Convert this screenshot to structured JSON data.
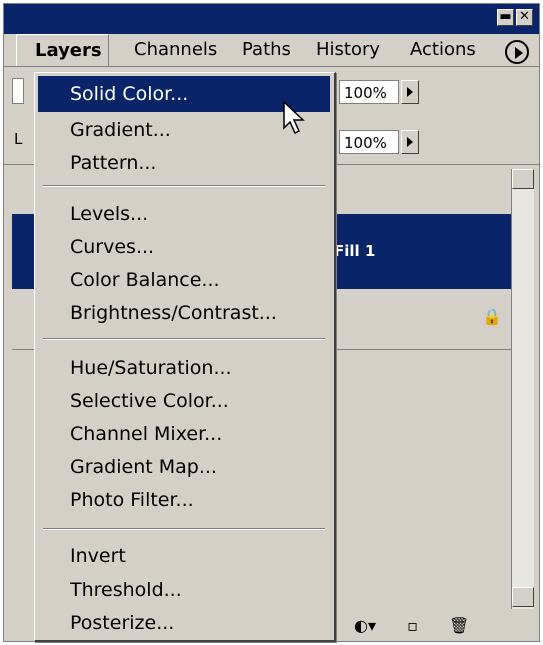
{
  "tabs": [
    {
      "label": "Layers",
      "active": true
    },
    {
      "label": "Channels",
      "active": false
    },
    {
      "label": "Paths",
      "active": false
    },
    {
      "label": "History",
      "active": false
    },
    {
      "label": "Actions",
      "active": false
    }
  ],
  "panel": {
    "opacity_value": "100%",
    "fill_value": "100%",
    "lock_label": "L",
    "selected_layer_name": "Fill 1"
  },
  "menu": {
    "items": [
      {
        "label": "Solid Color...",
        "highlighted": true
      },
      {
        "label": "Gradient..."
      },
      {
        "label": "Pattern..."
      },
      {
        "label": "Levels..."
      },
      {
        "label": "Curves..."
      },
      {
        "label": "Color Balance..."
      },
      {
        "label": "Brightness/Contrast..."
      },
      {
        "label": "Hue/Saturation..."
      },
      {
        "label": "Selective Color..."
      },
      {
        "label": "Channel Mixer..."
      },
      {
        "label": "Gradient Map..."
      },
      {
        "label": "Photo Filter..."
      },
      {
        "label": "Invert"
      },
      {
        "label": "Threshold..."
      },
      {
        "label": "Posterize..."
      }
    ]
  },
  "icons": [
    "minimize-icon",
    "close-icon",
    "palette-menu-icon",
    "lock-icon",
    "adjustment-layer-icon",
    "new-layer-icon",
    "trash-icon",
    "cursor-icon"
  ],
  "colors": {
    "selection": "#0a246a",
    "panel": "#d4d0c8"
  }
}
